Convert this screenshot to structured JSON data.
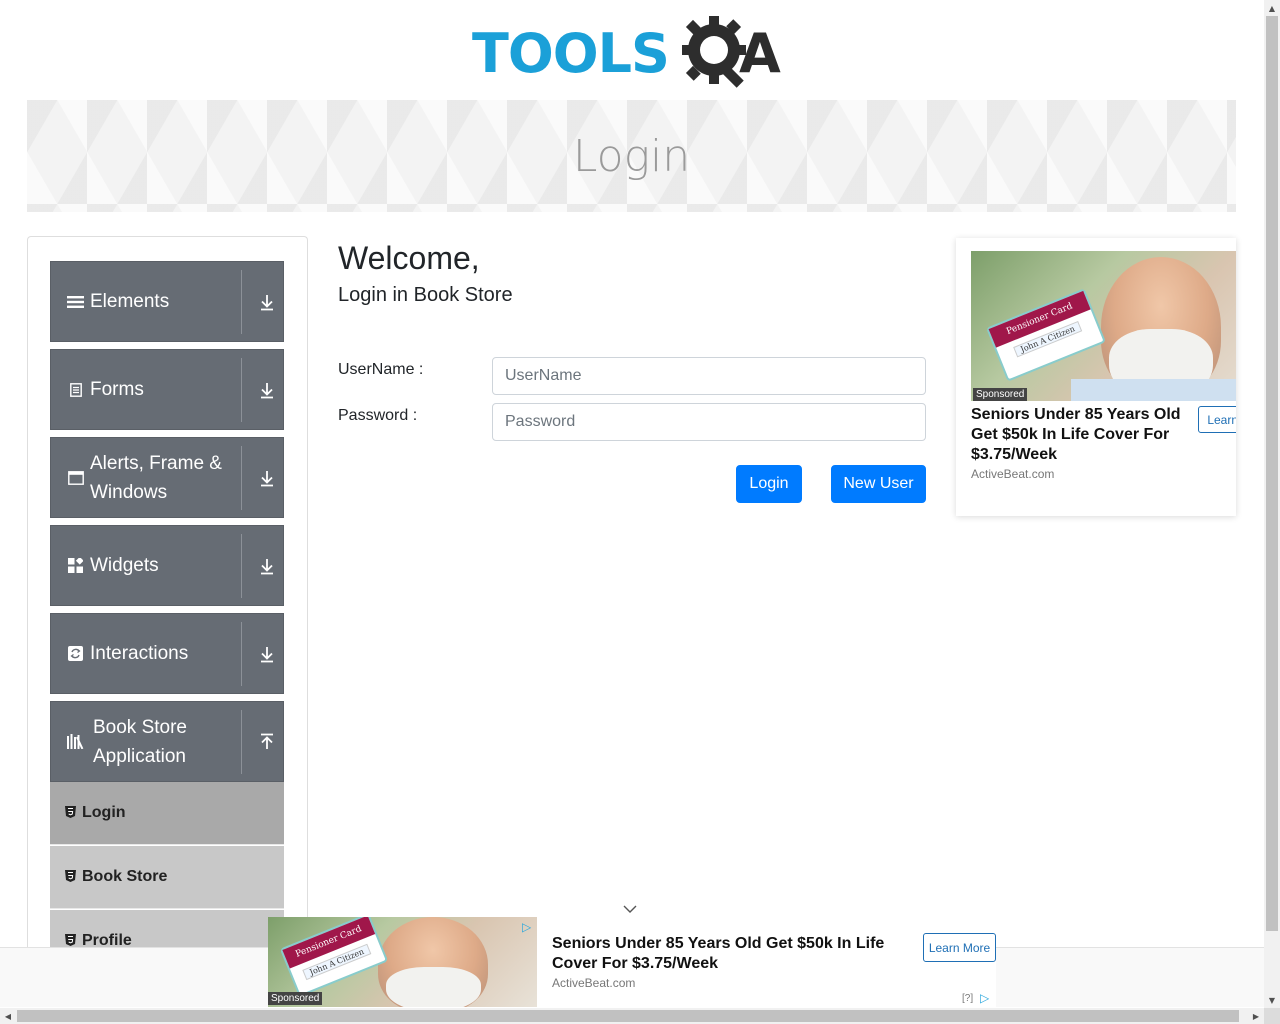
{
  "header": {
    "logo_tools": "TOOLS",
    "logo_qa": "A",
    "banner_title": "Login"
  },
  "sidebar": {
    "groups": [
      {
        "label": "Elements",
        "icon": "hamburger-icon",
        "expanded": false
      },
      {
        "label": "Forms",
        "icon": "document-icon",
        "expanded": false
      },
      {
        "label": "Alerts, Frame & Windows",
        "icon": "window-icon",
        "expanded": false
      },
      {
        "label": "Widgets",
        "icon": "widgets-icon",
        "expanded": false
      },
      {
        "label": "Interactions",
        "icon": "interactions-icon",
        "expanded": false
      },
      {
        "label": "Book Store Application",
        "icon": "books-icon",
        "expanded": true
      }
    ],
    "book_store_items": [
      {
        "label": "Login",
        "active": true
      },
      {
        "label": "Book Store",
        "active": false
      },
      {
        "label": "Profile",
        "active": false
      }
    ]
  },
  "main": {
    "welcome": "Welcome,",
    "subtitle": "Login in Book Store",
    "username_label": "UserName :",
    "username_placeholder": "UserName",
    "username_value": "",
    "password_label": "Password :",
    "password_placeholder": "Password",
    "password_value": "",
    "login_button": "Login",
    "new_user_button": "New User"
  },
  "ad_right": {
    "card_title": "Pensioner Card",
    "card_name": "John A Citizen",
    "sponsored": "Sponsored",
    "title": "Seniors Under 85 Years Old Get $50k In Life Cover For $3.75/Week",
    "domain": "ActiveBeat.com",
    "cta": "Learn More",
    "info": "[?]"
  },
  "ad_bottom": {
    "card_title": "Pensioner Card",
    "card_name": "John A Citizen",
    "sponsored": "Sponsored",
    "title": "Seniors Under 85 Years Old Get $50k In Life Cover For $3.75/Week",
    "domain": "ActiveBeat.com",
    "cta": "Learn More",
    "info": "[?]"
  },
  "colors": {
    "accent": "#007bff",
    "sidebar_group": "#666c74",
    "sidebar_active_item": "#a9a9a9",
    "sidebar_item": "#c8c8c8",
    "logo_blue": "#1ba0d8"
  }
}
